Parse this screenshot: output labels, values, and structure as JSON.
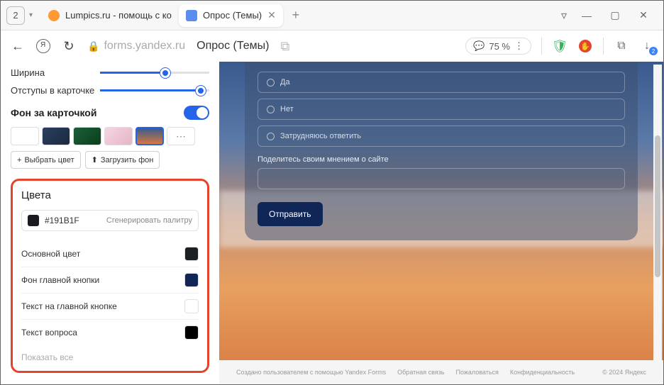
{
  "titlebar": {
    "tab_count": "2",
    "tab1_label": "Lumpics.ru - помощь с ко",
    "tab2_label": "Опрос (Темы)"
  },
  "addressbar": {
    "domain": "forms.yandex.ru",
    "title": "Опрос (Темы)",
    "zoom": "75 %"
  },
  "sidebar": {
    "width_label": "Ширина",
    "padding_label": "Отступы в карточке",
    "bg_section_title": "Фон за карточкой",
    "choose_color_btn": "Выбрать цвет",
    "upload_bg_btn": "Загрузить фон"
  },
  "colors": {
    "title": "Цвета",
    "hex": "#191B1F",
    "gen_palette": "Сгенерировать палитру",
    "rows": [
      {
        "label": "Основной цвет",
        "color": "#1c1f24"
      },
      {
        "label": "Фон главной кнопки",
        "color": "#0f2657"
      },
      {
        "label": "Текст на главной кнопке",
        "color": "#ffffff"
      },
      {
        "label": "Текст вопроса",
        "color": "#000000"
      }
    ],
    "show_all": "Показать все"
  },
  "preview": {
    "options": [
      "Да",
      "Нет",
      "Затрудняюсь ответить"
    ],
    "opinion_label": "Поделитесь своим мнением о сайте",
    "submit": "Отправить"
  },
  "footer": {
    "created": "Создано пользователем с помощью Yandex Forms",
    "feedback": "Обратная связь",
    "report": "Пожаловаться",
    "privacy": "Конфиденциальность",
    "copyright": "© 2024 Яндекс"
  }
}
